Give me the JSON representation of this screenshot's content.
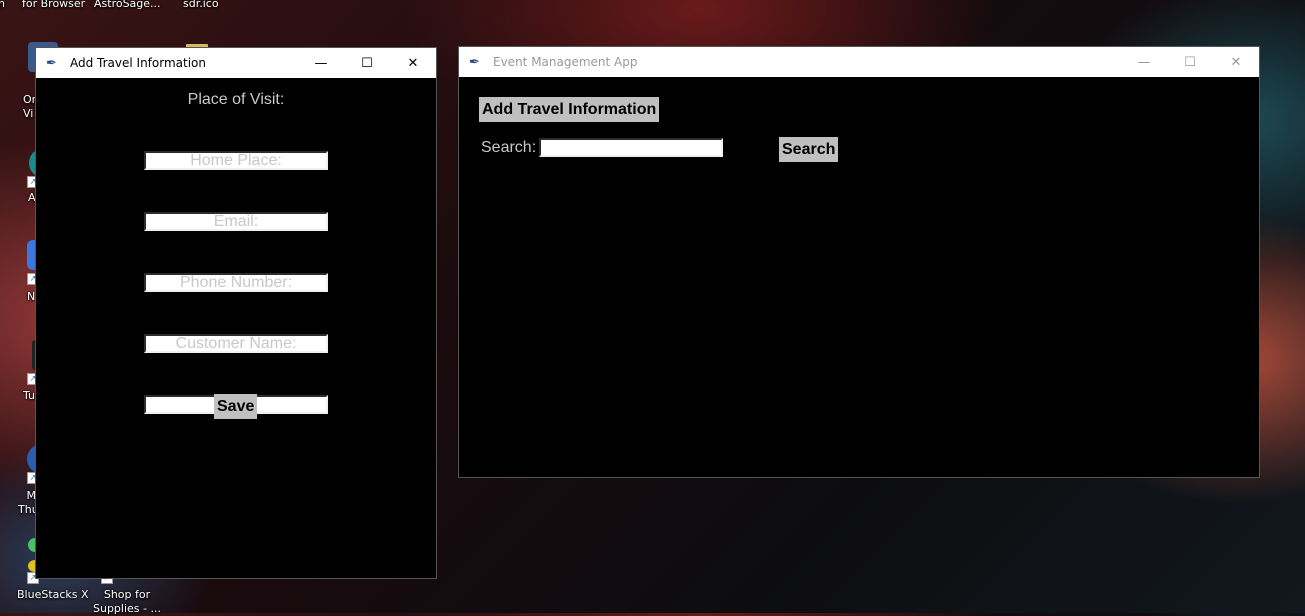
{
  "desktop": {
    "top_labels": [
      "n",
      "for Browser",
      "AstroSage...",
      "sdr.ico"
    ],
    "icons": [
      {
        "label": "Or Vi",
        "name": "oracle-virtualbox"
      },
      {
        "label": "A",
        "name": "app-a"
      },
      {
        "label": "N",
        "name": "app-n"
      },
      {
        "label": "Tu",
        "name": "app-tu"
      },
      {
        "label": "M Thu",
        "name": "mozilla-thunderbird"
      },
      {
        "label": "BlueStacks X",
        "name": "bluestacks-x"
      },
      {
        "label": "Shop for Supplies - ...",
        "name": "shop-for-supplies"
      }
    ]
  },
  "travel_window": {
    "title": "Add Travel Information",
    "controls": {
      "minimize": "—",
      "maximize": "☐",
      "close": "✕"
    },
    "fields": [
      {
        "label": "Place of Visit:",
        "value": ""
      },
      {
        "label": "Home Place:",
        "value": ""
      },
      {
        "label": "Email:",
        "value": ""
      },
      {
        "label": "Phone Number:",
        "value": ""
      },
      {
        "label": "Customer Name:",
        "value": ""
      }
    ],
    "save_label": "Save"
  },
  "event_window": {
    "title": "Event Management App",
    "controls": {
      "minimize": "—",
      "maximize": "☐",
      "close": "✕"
    },
    "add_button_label": "Add Travel Information",
    "search_label": "Search:",
    "search_value": "",
    "search_button_label": "Search"
  }
}
